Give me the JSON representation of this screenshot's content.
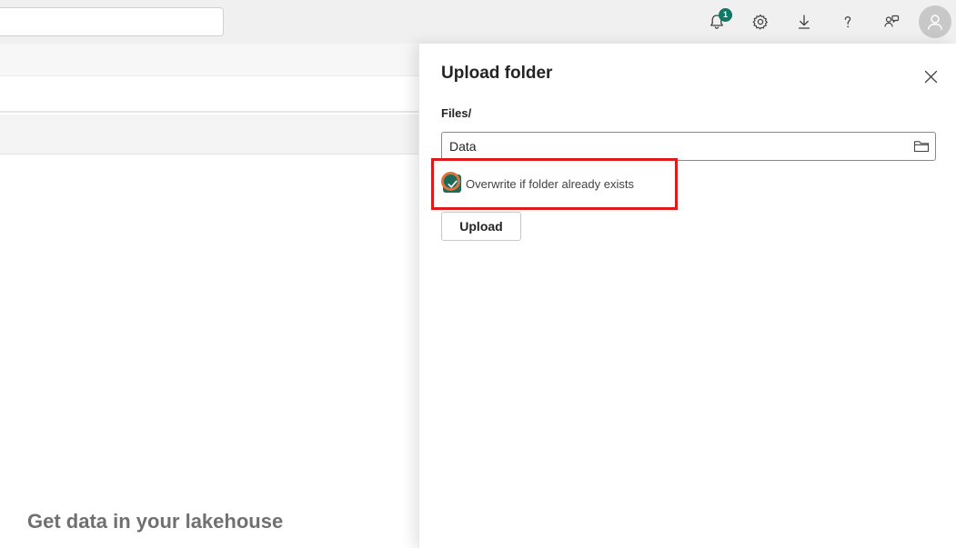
{
  "topbar": {
    "search": {
      "value": ""
    },
    "notifications": {
      "count": "1",
      "icon": "bell-icon"
    },
    "icons": [
      "bell-icon",
      "gear-icon",
      "download-icon",
      "help-icon",
      "feedback-icon",
      "avatar-icon"
    ]
  },
  "background": {
    "heading": "Get data in your lakehouse"
  },
  "panel": {
    "title": "Upload folder",
    "path_label": "Files/",
    "folder_input": {
      "value": "Data",
      "icon": "folder-icon"
    },
    "overwrite_checkbox": {
      "label": "Overwrite if folder already exists",
      "checked": true
    },
    "upload_label": "Upload",
    "close_icon": "close-icon"
  },
  "colors": {
    "accent": "#117865",
    "checkbox_fill": "#1b6a5a",
    "highlight_box": "#e01a1a",
    "cursor_ring": "#e2703a"
  }
}
